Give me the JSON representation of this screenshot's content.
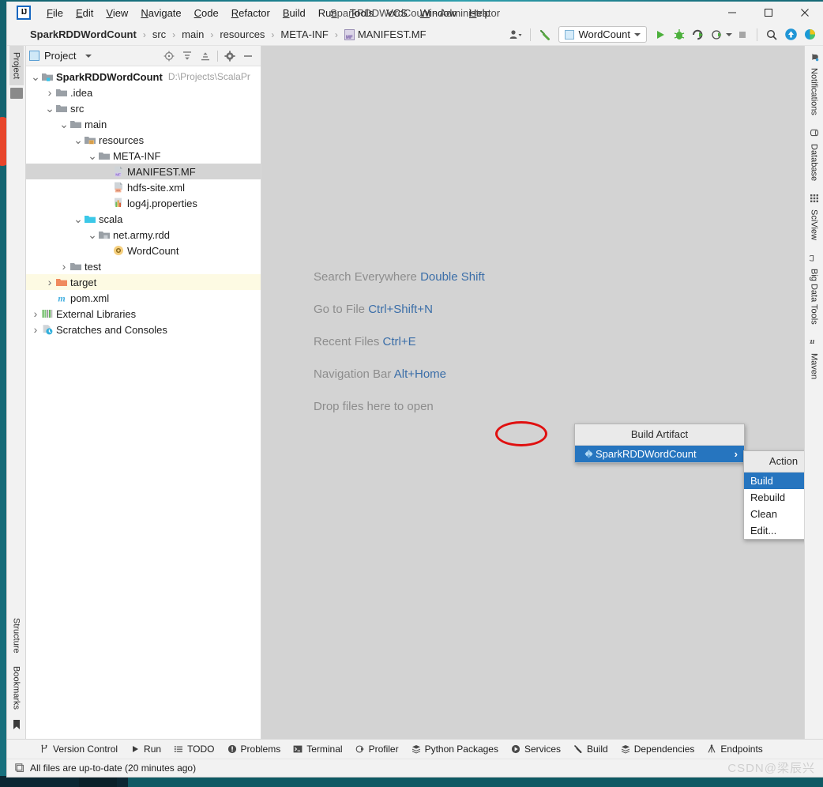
{
  "window": {
    "title": "SparkRDDWordCount - Administrator",
    "app_icon": "intellij-idea-icon",
    "controls": {
      "minimize": "minimize-icon",
      "maximize": "maximize-icon",
      "close": "close-icon"
    }
  },
  "menubar": {
    "items": [
      {
        "label": "File",
        "mnemonic": "F"
      },
      {
        "label": "Edit",
        "mnemonic": "E"
      },
      {
        "label": "View",
        "mnemonic": "V"
      },
      {
        "label": "Navigate",
        "mnemonic": "N"
      },
      {
        "label": "Code",
        "mnemonic": "C"
      },
      {
        "label": "Refactor",
        "mnemonic": "R"
      },
      {
        "label": "Build",
        "mnemonic": "B"
      },
      {
        "label": "Run",
        "mnemonic": "n"
      },
      {
        "label": "Tools",
        "mnemonic": "T"
      },
      {
        "label": "VCS",
        "mnemonic": ""
      },
      {
        "label": "Window",
        "mnemonic": "W"
      },
      {
        "label": "Help",
        "mnemonic": "H"
      }
    ]
  },
  "navbar": {
    "breadcrumbs": [
      {
        "label": "SparkRDDWordCount",
        "bold": true,
        "icon": ""
      },
      {
        "label": "src",
        "bold": false,
        "icon": ""
      },
      {
        "label": "main",
        "bold": false,
        "icon": ""
      },
      {
        "label": "resources",
        "bold": false,
        "icon": ""
      },
      {
        "label": "META-INF",
        "bold": false,
        "icon": ""
      },
      {
        "label": "MANIFEST.MF",
        "bold": false,
        "icon": "manifest-file-icon"
      }
    ],
    "separator": "›",
    "run_configuration": "WordCount",
    "toolbar_icons": [
      "user-account-icon",
      "build-hammer-icon",
      "run-icon",
      "debug-icon",
      "run-with-coverage-icon",
      "profile-icon",
      "stop-icon",
      "search-icon",
      "update-project-icon",
      "ide-assistant-icon"
    ]
  },
  "left_strip": {
    "top": [
      {
        "label": "Project",
        "icon": "project-folder-icon",
        "active": true
      }
    ],
    "bottom": [
      {
        "label": "Structure",
        "icon": "structure-icon"
      },
      {
        "label": "Bookmarks",
        "icon": "bookmark-icon"
      }
    ]
  },
  "right_strip": [
    {
      "label": "Notifications",
      "icon": "notifications-bell-icon"
    },
    {
      "label": "Database",
      "icon": "database-icon"
    },
    {
      "label": "SciView",
      "icon": "sciview-grid-icon"
    },
    {
      "label": "Big Data Tools",
      "icon": "big-data-tools-icon"
    },
    {
      "label": "Maven",
      "icon": "maven-icon"
    }
  ],
  "project_panel": {
    "title": "Project",
    "title_icon": "project-view-icon",
    "dropdown_icon": "chevron-down-icon",
    "actions": [
      "locate-in-tree-icon",
      "expand-all-icon",
      "collapse-all-icon",
      "settings-gear-icon",
      "hide-panel-icon"
    ],
    "tree": [
      {
        "indent": 0,
        "arrow": "v",
        "icon": "module-folder-icon",
        "label": "SparkRDDWordCount",
        "bold": true,
        "path": "D:\\Projects\\ScalaPr",
        "state": ""
      },
      {
        "indent": 1,
        "arrow": ">",
        "icon": "folder-icon",
        "label": ".idea",
        "bold": false,
        "path": "",
        "state": ""
      },
      {
        "indent": 1,
        "arrow": "v",
        "icon": "folder-icon",
        "label": "src",
        "bold": false,
        "path": "",
        "state": ""
      },
      {
        "indent": 2,
        "arrow": "v",
        "icon": "folder-icon",
        "label": "main",
        "bold": false,
        "path": "",
        "state": ""
      },
      {
        "indent": 3,
        "arrow": "v",
        "icon": "resources-folder-icon",
        "label": "resources",
        "bold": false,
        "path": "",
        "state": ""
      },
      {
        "indent": 4,
        "arrow": "v",
        "icon": "folder-icon",
        "label": "META-INF",
        "bold": false,
        "path": "",
        "state": ""
      },
      {
        "indent": 5,
        "arrow": "",
        "icon": "manifest-file-icon",
        "label": "MANIFEST.MF",
        "bold": false,
        "path": "",
        "state": "selected"
      },
      {
        "indent": 5,
        "arrow": "",
        "icon": "xml-file-icon",
        "label": "hdfs-site.xml",
        "bold": false,
        "path": "",
        "state": ""
      },
      {
        "indent": 5,
        "arrow": "",
        "icon": "properties-file-icon",
        "label": "log4j.properties",
        "bold": false,
        "path": "",
        "state": ""
      },
      {
        "indent": 3,
        "arrow": "v",
        "icon": "sources-folder-icon",
        "label": "scala",
        "bold": false,
        "path": "",
        "state": ""
      },
      {
        "indent": 4,
        "arrow": "v",
        "icon": "package-icon",
        "label": "net.army.rdd",
        "bold": false,
        "path": "",
        "state": ""
      },
      {
        "indent": 5,
        "arrow": "",
        "icon": "scala-object-icon",
        "label": "WordCount",
        "bold": false,
        "path": "",
        "state": ""
      },
      {
        "indent": 2,
        "arrow": ">",
        "icon": "folder-icon",
        "label": "test",
        "bold": false,
        "path": "",
        "state": ""
      },
      {
        "indent": 1,
        "arrow": ">",
        "icon": "excluded-folder-icon",
        "label": "target",
        "bold": false,
        "path": "",
        "state": "highlight"
      },
      {
        "indent": 1,
        "arrow": "",
        "icon": "maven-pom-icon",
        "label": "pom.xml",
        "bold": false,
        "path": "",
        "state": ""
      },
      {
        "indent": 0,
        "arrow": ">",
        "icon": "external-libraries-icon",
        "label": "External Libraries",
        "bold": false,
        "path": "",
        "state": ""
      },
      {
        "indent": 0,
        "arrow": ">",
        "icon": "scratches-icon",
        "label": "Scratches and Consoles",
        "bold": false,
        "path": "",
        "state": ""
      }
    ]
  },
  "editor": {
    "hints": [
      {
        "text": "Search Everywhere ",
        "key": "Double Shift"
      },
      {
        "text": "Go to File ",
        "key": "Ctrl+Shift+N"
      },
      {
        "text": "Recent Files ",
        "key": "Ctrl+E"
      },
      {
        "text": "Navigation Bar ",
        "key": "Alt+Home"
      },
      {
        "text": "Drop files here to open",
        "key": ""
      }
    ]
  },
  "popups": {
    "build_artifact": {
      "title": "Build Artifact",
      "items": [
        {
          "label": "SparkRDDWordCount",
          "icon": "artifact-icon",
          "submenu_arrow": "›",
          "selected": true
        }
      ]
    },
    "action": {
      "title": "Action",
      "items": [
        {
          "label": "Build",
          "selected": true
        },
        {
          "label": "Rebuild",
          "selected": false
        },
        {
          "label": "Clean",
          "selected": false
        },
        {
          "label": "Edit...",
          "selected": false
        }
      ]
    },
    "annotation": {
      "shape": "red-ellipse",
      "color": "#e01010",
      "target": "Build"
    }
  },
  "tool_windows": [
    {
      "label": "Version Control",
      "icon": "branch-icon"
    },
    {
      "label": "Run",
      "icon": "run-icon"
    },
    {
      "label": "TODO",
      "icon": "todo-list-icon"
    },
    {
      "label": "Problems",
      "icon": "problems-icon"
    },
    {
      "label": "Terminal",
      "icon": "terminal-icon"
    },
    {
      "label": "Profiler",
      "icon": "profiler-icon"
    },
    {
      "label": "Python Packages",
      "icon": "packages-icon"
    },
    {
      "label": "Services",
      "icon": "services-icon"
    },
    {
      "label": "Build",
      "icon": "build-hammer-icon"
    },
    {
      "label": "Dependencies",
      "icon": "dependencies-icon"
    },
    {
      "label": "Endpoints",
      "icon": "endpoints-icon"
    }
  ],
  "statusbar": {
    "icon": "vcs-widget-icon",
    "message": "All files are up-to-date (20 minutes ago)",
    "watermark": "CSDN@梁辰兴"
  },
  "colors": {
    "accent_blue": "#2675bf",
    "annotation_red": "#e01010",
    "selection_gray": "#d4d4d4",
    "highlight_yellow": "#fdfae3",
    "editor_bg": "#d3d3d3"
  }
}
